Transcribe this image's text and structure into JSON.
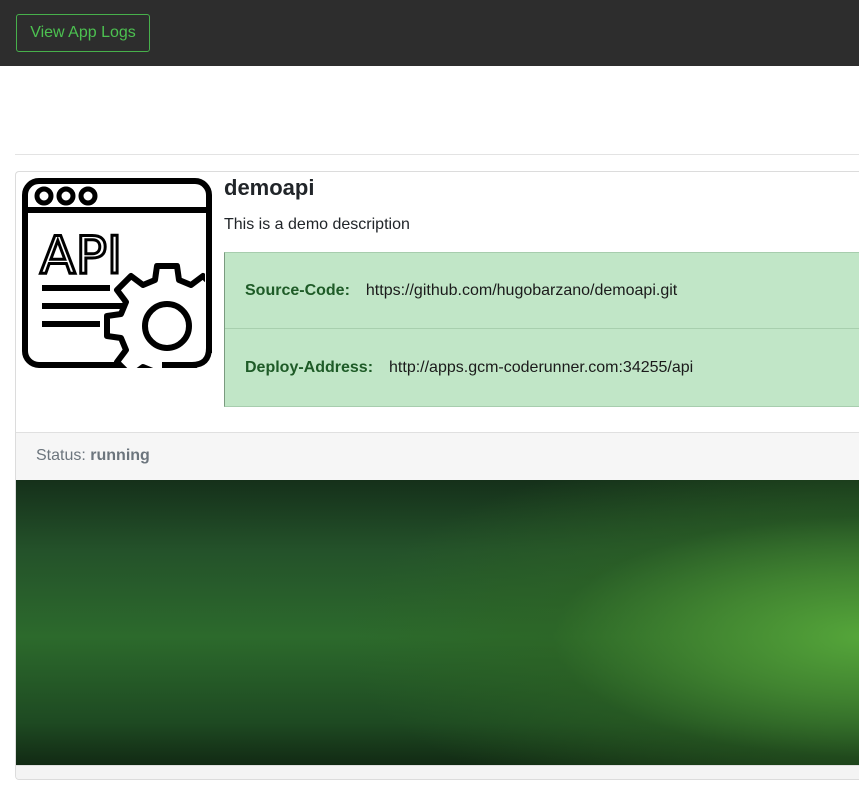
{
  "header": {
    "logs_button_label": "View App Logs"
  },
  "app": {
    "name": "demoapi",
    "description": "This is a demo description",
    "icon": "api-gear-icon",
    "info": [
      {
        "label": "Source-Code:",
        "value": "https://github.com/hugobarzano/demoapi.git"
      },
      {
        "label": "Deploy-Address:",
        "value": "http://apps.gcm-coderunner.com:34255/api"
      }
    ],
    "status_label": "Status:",
    "status_value": "running"
  },
  "colors": {
    "topbar": "#2d2d2d",
    "accent_green": "#4cc150",
    "info_bg": "#c1e6c7",
    "info_label": "#1e5b27"
  }
}
